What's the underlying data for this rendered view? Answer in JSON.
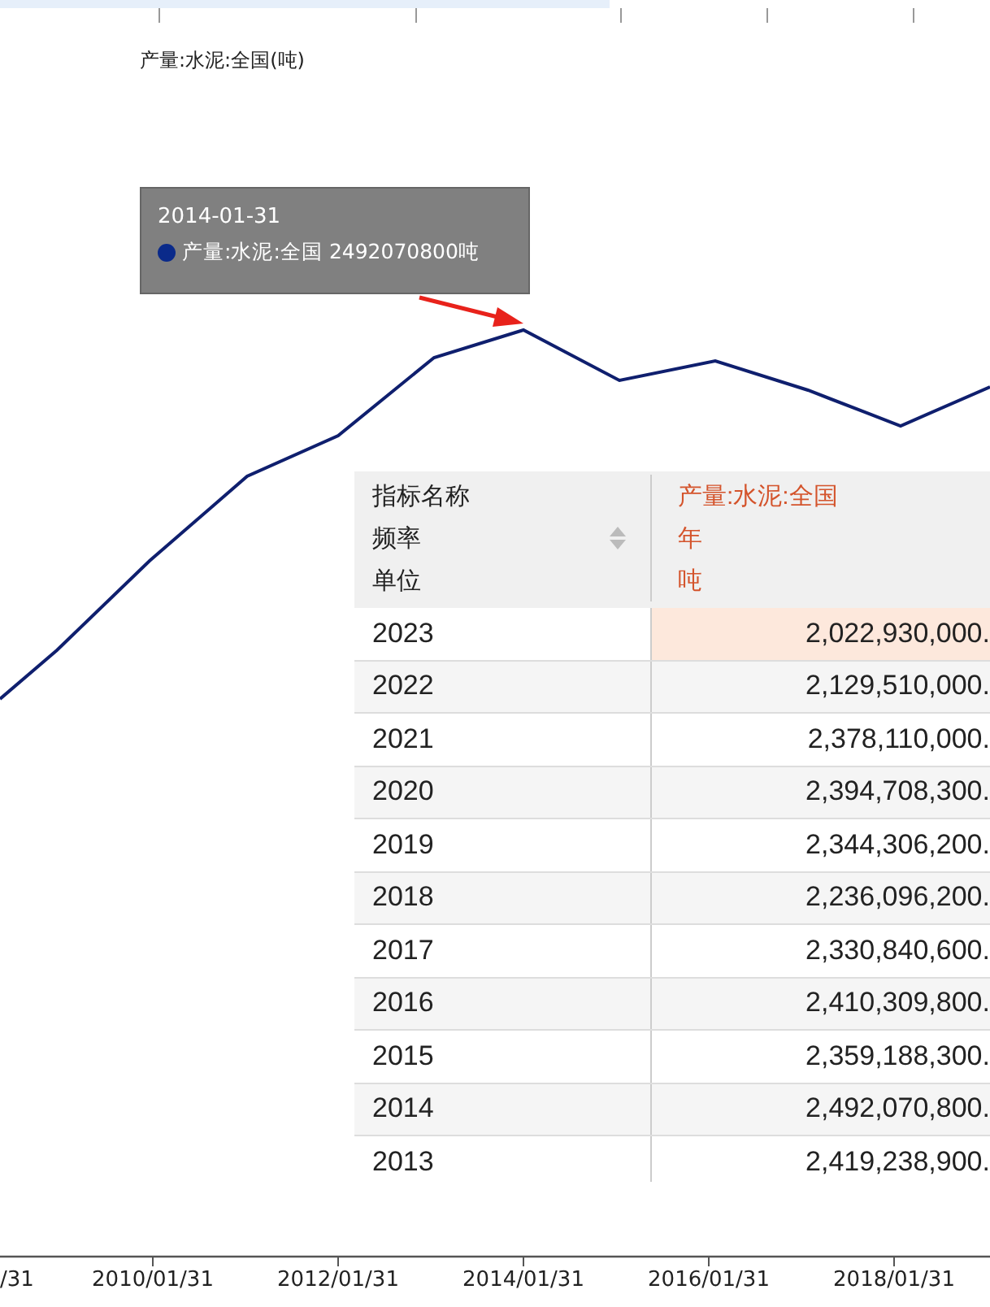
{
  "chart": {
    "legend": "产量:水泥:全国(吨)",
    "x_labels": [
      "/31",
      "2010/01/31",
      "2012/01/31",
      "2014/01/31",
      "2016/01/31",
      "2018/01/31"
    ]
  },
  "tooltip": {
    "date": "2014-01-31",
    "series": "产量:水泥:全国",
    "value": "2492070800吨",
    "color": "#0a2a8a"
  },
  "table": {
    "header": [
      {
        "label": "指标名称",
        "value": "产量:水泥:全国"
      },
      {
        "label": "频率",
        "value": "年"
      },
      {
        "label": "单位",
        "value": "吨"
      }
    ],
    "rows": [
      {
        "year": "2023",
        "value": "2,022,930,000.",
        "selected": true
      },
      {
        "year": "2022",
        "value": "2,129,510,000.",
        "selected": false
      },
      {
        "year": "2021",
        "value": "2,378,110,000.",
        "selected": false
      },
      {
        "year": "2020",
        "value": "2,394,708,300.",
        "selected": false
      },
      {
        "year": "2019",
        "value": "2,344,306,200.",
        "selected": false
      },
      {
        "year": "2018",
        "value": "2,236,096,200.",
        "selected": false
      },
      {
        "year": "2017",
        "value": "2,330,840,600.",
        "selected": false
      },
      {
        "year": "2016",
        "value": "2,410,309,800.",
        "selected": false
      },
      {
        "year": "2015",
        "value": "2,359,188,300.",
        "selected": false
      },
      {
        "year": "2014",
        "value": "2,492,070,800.",
        "selected": false
      },
      {
        "year": "2013",
        "value": "2,419,238,900.",
        "selected": false
      }
    ]
  }
}
